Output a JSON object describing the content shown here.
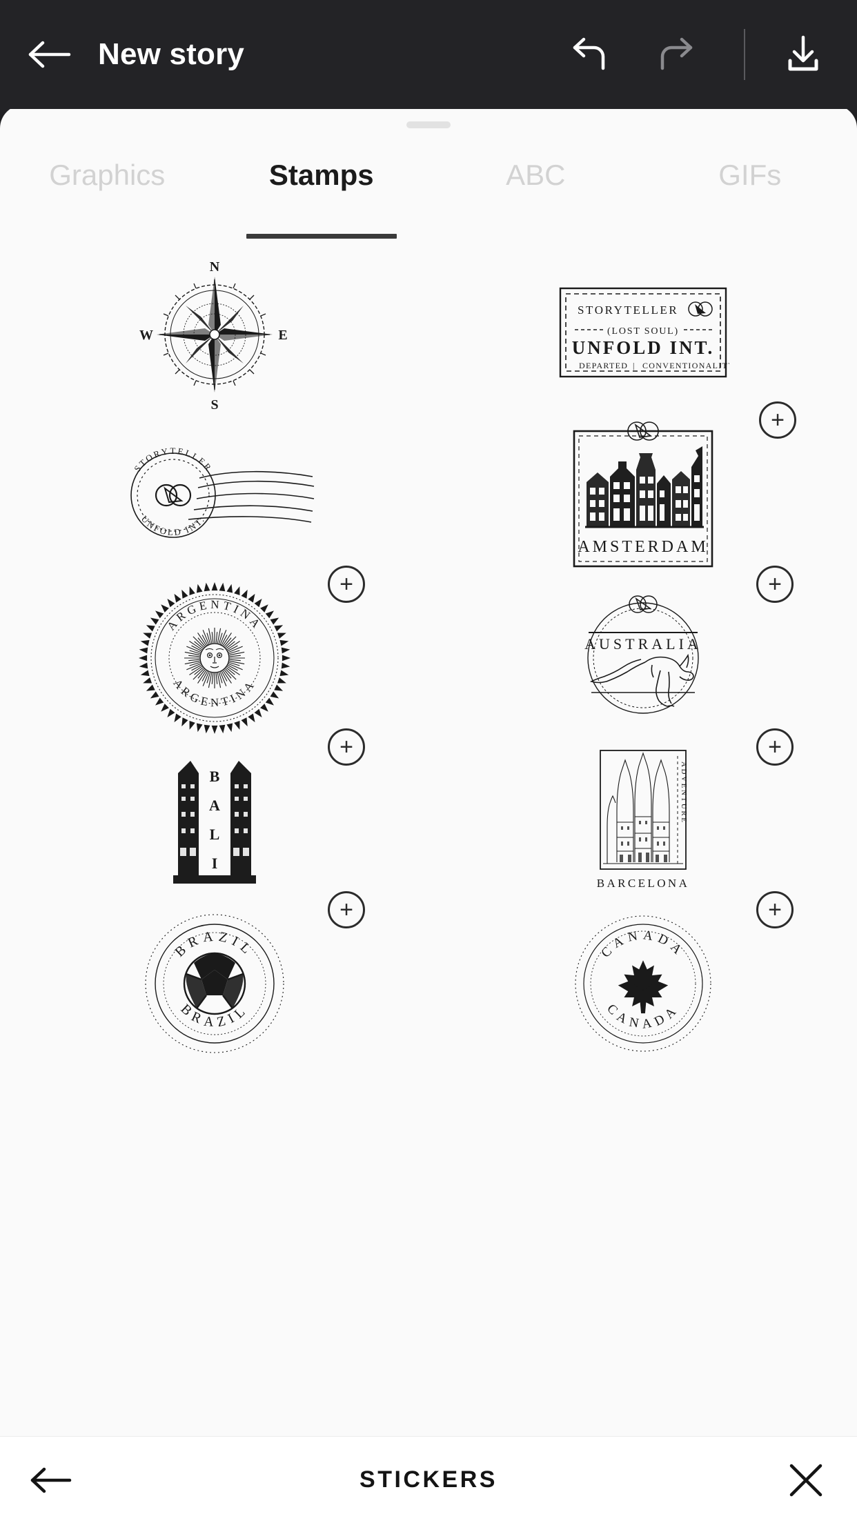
{
  "header": {
    "title": "New story",
    "back_icon": "arrow-left-icon",
    "undo_icon": "undo-arrow-icon",
    "redo_icon": "redo-arrow-icon",
    "download_icon": "download-icon",
    "background_color": "#232326",
    "text_color": "#ffffff",
    "redo_disabled_color": "#8a8a8e"
  },
  "sheet": {
    "grabber": "drag-handle",
    "background_color": "#fafafa"
  },
  "tabs": [
    {
      "label": "Graphics",
      "active": false
    },
    {
      "label": "Stamps",
      "active": true
    },
    {
      "label": "ABC",
      "active": false
    },
    {
      "label": "GIFs",
      "active": false
    }
  ],
  "tab_styles": {
    "active_color": "#1b1b1b",
    "inactive_color": "#d2d2d2",
    "underline_color": "#3a3a3a"
  },
  "stickers": [
    {
      "id": "compass-rose",
      "name": "compass-rose-stamp",
      "add_badge": false,
      "labels": {
        "north": "N",
        "south": "S",
        "east": "E",
        "west": "W"
      }
    },
    {
      "id": "storyteller-rect",
      "name": "storyteller-rect-stamp",
      "add_badge": false,
      "lines": {
        "line1": "STORYTELLER",
        "line2": "(LOST SOUL)",
        "line3": "UNFOLD INT.",
        "line4_left": "DEPARTED",
        "line4_sep": "|",
        "line4_right": "CONVENTIONALITY"
      }
    },
    {
      "id": "storyteller-postmark",
      "name": "storyteller-postmark-stamp",
      "add_badge": false,
      "lines": {
        "top": "STORYTELLER",
        "bottom": "UNFOLD INT."
      }
    },
    {
      "id": "amsterdam",
      "name": "amsterdam-stamp",
      "add_badge": true,
      "lines": {
        "city": "AMSTERDAM"
      }
    },
    {
      "id": "argentina",
      "name": "argentina-stamp",
      "add_badge": true,
      "lines": {
        "top": "ARGENTINA",
        "bottom": "ARGENTINA"
      }
    },
    {
      "id": "australia",
      "name": "australia-stamp",
      "add_badge": true,
      "lines": {
        "country": "AUSTRALIA"
      }
    },
    {
      "id": "bali",
      "name": "bali-stamp",
      "add_badge": true,
      "lines": {
        "letters": [
          "B",
          "A",
          "L",
          "I"
        ]
      }
    },
    {
      "id": "barcelona",
      "name": "barcelona-stamp",
      "add_badge": true,
      "lines": {
        "vertical": "ADVENTURE",
        "city": "BARCELONA"
      }
    },
    {
      "id": "brazil",
      "name": "brazil-stamp",
      "add_badge": true,
      "lines": {
        "top": "BRAZIL",
        "bottom": "BRAZIL"
      }
    },
    {
      "id": "canada",
      "name": "canada-stamp",
      "add_badge": true,
      "lines": {
        "top": "CANADA",
        "bottom": "CANADA"
      }
    }
  ],
  "add_badge": {
    "glyph": "+",
    "label": "add-sticker"
  },
  "bottom_bar": {
    "title": "STICKERS",
    "back_icon": "arrow-left-icon",
    "close_icon": "close-x-icon",
    "background_color": "#ffffff"
  }
}
